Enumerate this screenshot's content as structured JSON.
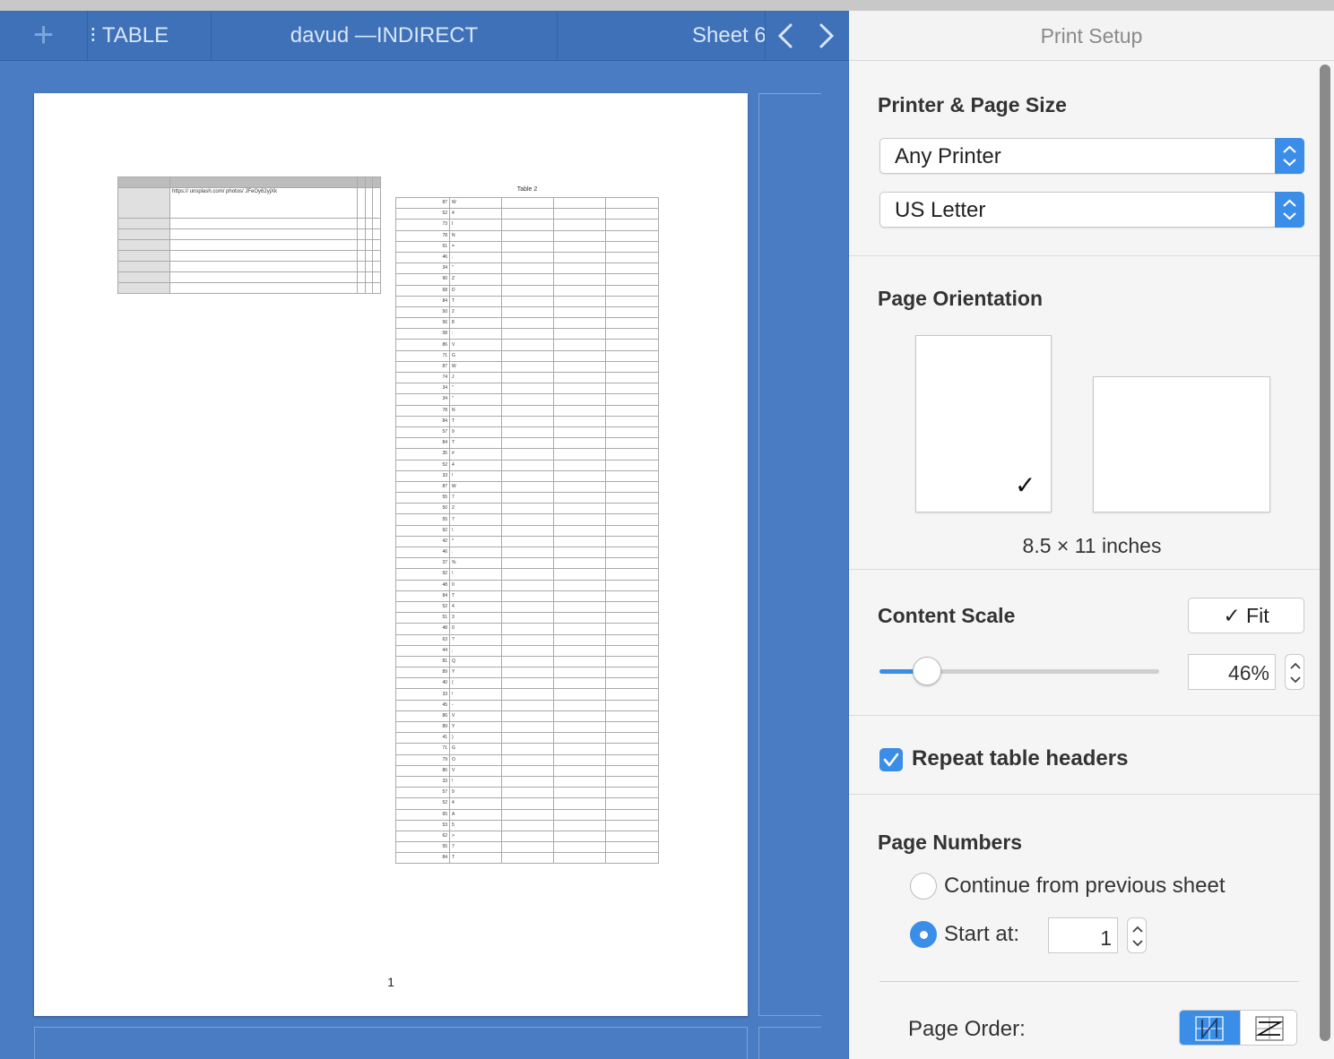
{
  "tabs": [
    {
      "label": "⁝ TABLE"
    },
    {
      "label": "davud —INDIRECT"
    },
    {
      "label": "Sheet 6"
    }
  ],
  "icons": {
    "add": "plus-icon",
    "prev": "chevron-left-icon",
    "next": "chevron-right-icon"
  },
  "preview": {
    "table1": {
      "url_text": "https:// unsplash.com/ photos/ JFeOy62yjXk"
    },
    "table2": {
      "title": "Table 2",
      "rows": [
        [
          "87",
          "W"
        ],
        [
          "52",
          "4"
        ],
        [
          "73",
          "I"
        ],
        [
          "78",
          "N"
        ],
        [
          "61",
          "="
        ],
        [
          "46",
          "."
        ],
        [
          "34",
          "\""
        ],
        [
          "90",
          "Z"
        ],
        [
          "68",
          "D"
        ],
        [
          "84",
          "T"
        ],
        [
          "50",
          "2"
        ],
        [
          "56",
          "8"
        ],
        [
          "58",
          ":"
        ],
        [
          "86",
          "V"
        ],
        [
          "71",
          "G"
        ],
        [
          "87",
          "W"
        ],
        [
          "74",
          "J"
        ],
        [
          "34",
          "\""
        ],
        [
          "34",
          "\""
        ],
        [
          "78",
          "N"
        ],
        [
          "84",
          "T"
        ],
        [
          "57",
          "9"
        ],
        [
          "84",
          "T"
        ],
        [
          "35",
          "#"
        ],
        [
          "52",
          "4"
        ],
        [
          "33",
          "!"
        ],
        [
          "87",
          "W"
        ],
        [
          "55",
          "7"
        ],
        [
          "50",
          "2"
        ],
        [
          "55",
          "7"
        ],
        [
          "92",
          "\\"
        ],
        [
          "42",
          "*"
        ],
        [
          "46",
          "."
        ],
        [
          "37",
          "%"
        ],
        [
          "92",
          "\\"
        ],
        [
          "48",
          "0"
        ],
        [
          "84",
          "T"
        ],
        [
          "52",
          "4"
        ],
        [
          "51",
          "3"
        ],
        [
          "48",
          "0"
        ],
        [
          "63",
          "?"
        ],
        [
          "44",
          ","
        ],
        [
          "81",
          "Q"
        ],
        [
          "89",
          "Y"
        ],
        [
          "40",
          "("
        ],
        [
          "33",
          "!"
        ],
        [
          "45",
          "-"
        ],
        [
          "86",
          "V"
        ],
        [
          "89",
          "Y"
        ],
        [
          "41",
          ")"
        ],
        [
          "71",
          "G"
        ],
        [
          "79",
          "O"
        ],
        [
          "86",
          "V"
        ],
        [
          "33",
          "!"
        ],
        [
          "57",
          "9"
        ],
        [
          "52",
          "4"
        ],
        [
          "65",
          "A"
        ],
        [
          "53",
          "5"
        ],
        [
          "62",
          ">"
        ],
        [
          "55",
          "7"
        ],
        [
          "84",
          "T"
        ]
      ]
    },
    "page_number": "1"
  },
  "print_setup": {
    "title": "Print Setup",
    "printer_section": {
      "heading": "Printer & Page Size",
      "printer": "Any Printer",
      "paper": "US Letter"
    },
    "orientation_section": {
      "heading": "Page Orientation",
      "selected": "portrait",
      "check": "✓",
      "dimensions": "8.5 × 11 inches"
    },
    "scale_section": {
      "heading": "Content Scale",
      "fit_label": "✓ Fit",
      "scale_value": "46%",
      "scale_fraction": 0.17
    },
    "repeat_headers": {
      "label": "Repeat table headers",
      "checked": true
    },
    "page_numbers": {
      "heading": "Page Numbers",
      "continue_label": "Continue from previous sheet",
      "start_label": "Start at:",
      "start_value": "1",
      "selected": "start"
    },
    "page_order": {
      "label": "Page Order:"
    }
  },
  "colors": {
    "accent": "#3a8ee8",
    "tabbar": "#3f71b8",
    "canvas": "#4a7cc4"
  }
}
